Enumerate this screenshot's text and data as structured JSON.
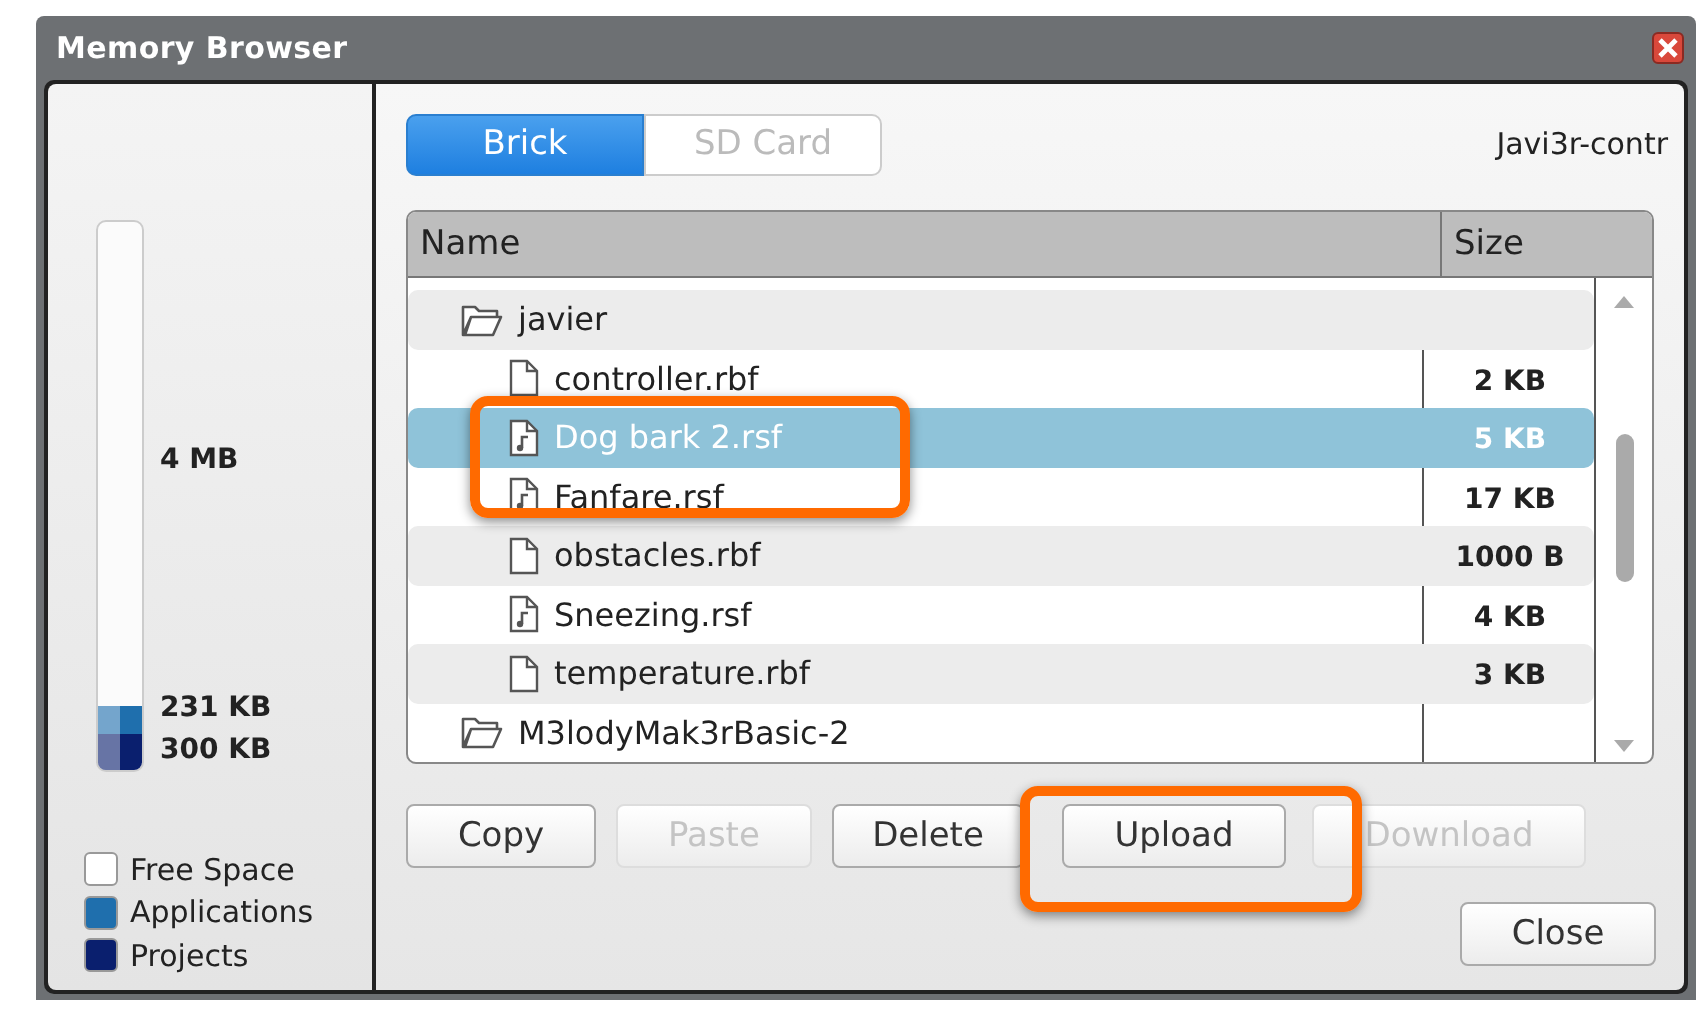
{
  "window": {
    "title": "Memory Browser"
  },
  "storage_meter": {
    "segments": [
      {
        "level": 0.066,
        "color": "#0a1f6e"
      },
      {
        "level": 0.05,
        "color": "#1f6fad"
      }
    ],
    "readings": [
      "4 MB",
      "231 KB",
      "300 KB"
    ]
  },
  "legend": [
    {
      "label": "Free Space",
      "color": "#ffffff"
    },
    {
      "label": "Applications",
      "color": "#1f6fad"
    },
    {
      "label": "Projects",
      "color": "#0a1f6e"
    }
  ],
  "tabs": [
    {
      "label": "Brick",
      "selected": true
    },
    {
      "label": "SD Card",
      "selected": false
    }
  ],
  "device_name": "Javi3r-contr",
  "table": {
    "columns": [
      "Name",
      "Size"
    ],
    "rows": [
      {
        "name": "javier",
        "kind": "folder",
        "selected": false,
        "children": [
          {
            "name": "controller.rbf",
            "kind": "file",
            "size": "2 KB",
            "selected": false
          },
          {
            "name": "Dog bark 2.rsf",
            "kind": "sound",
            "size": "5 KB",
            "selected": true
          },
          {
            "name": "Fanfare.rsf",
            "kind": "sound",
            "size": "17 KB",
            "selected": false
          },
          {
            "name": "obstacles.rbf",
            "kind": "file",
            "size": "1000 B",
            "selected": false
          },
          {
            "name": "Sneezing.rsf",
            "kind": "sound",
            "size": "4 KB",
            "selected": false
          },
          {
            "name": "temperature.rbf",
            "kind": "file",
            "size": "3 KB",
            "selected": false
          }
        ]
      },
      {
        "name": "M3lodyMak3rBasic-2",
        "kind": "folder",
        "selected": false
      }
    ]
  },
  "buttons": [
    {
      "label": "Copy",
      "disabled": false
    },
    {
      "label": "Paste",
      "disabled": true
    },
    {
      "label": "Delete",
      "disabled": false
    },
    {
      "label": "Upload",
      "disabled": false
    },
    {
      "label": "Download",
      "disabled": true
    }
  ],
  "close_button": "Close"
}
